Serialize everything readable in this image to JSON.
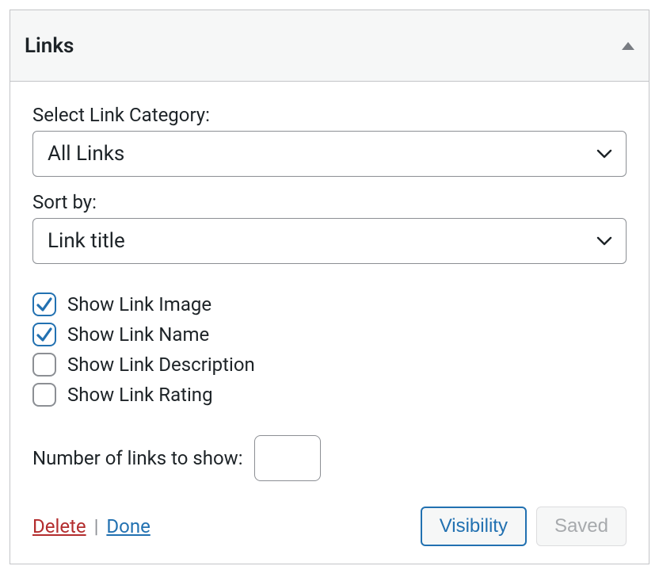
{
  "widget": {
    "title": "Links"
  },
  "fields": {
    "category": {
      "label": "Select Link Category:",
      "value": "All Links"
    },
    "sort": {
      "label": "Sort by:",
      "value": "Link title"
    },
    "number": {
      "label": "Number of links to show:",
      "value": ""
    }
  },
  "checkboxes": {
    "image": {
      "label": "Show Link Image",
      "checked": true
    },
    "name": {
      "label": "Show Link Name",
      "checked": true
    },
    "description": {
      "label": "Show Link Description",
      "checked": false
    },
    "rating": {
      "label": "Show Link Rating",
      "checked": false
    }
  },
  "footer": {
    "delete": "Delete",
    "separator": "|",
    "done": "Done",
    "visibility": "Visibility",
    "saved": "Saved"
  }
}
